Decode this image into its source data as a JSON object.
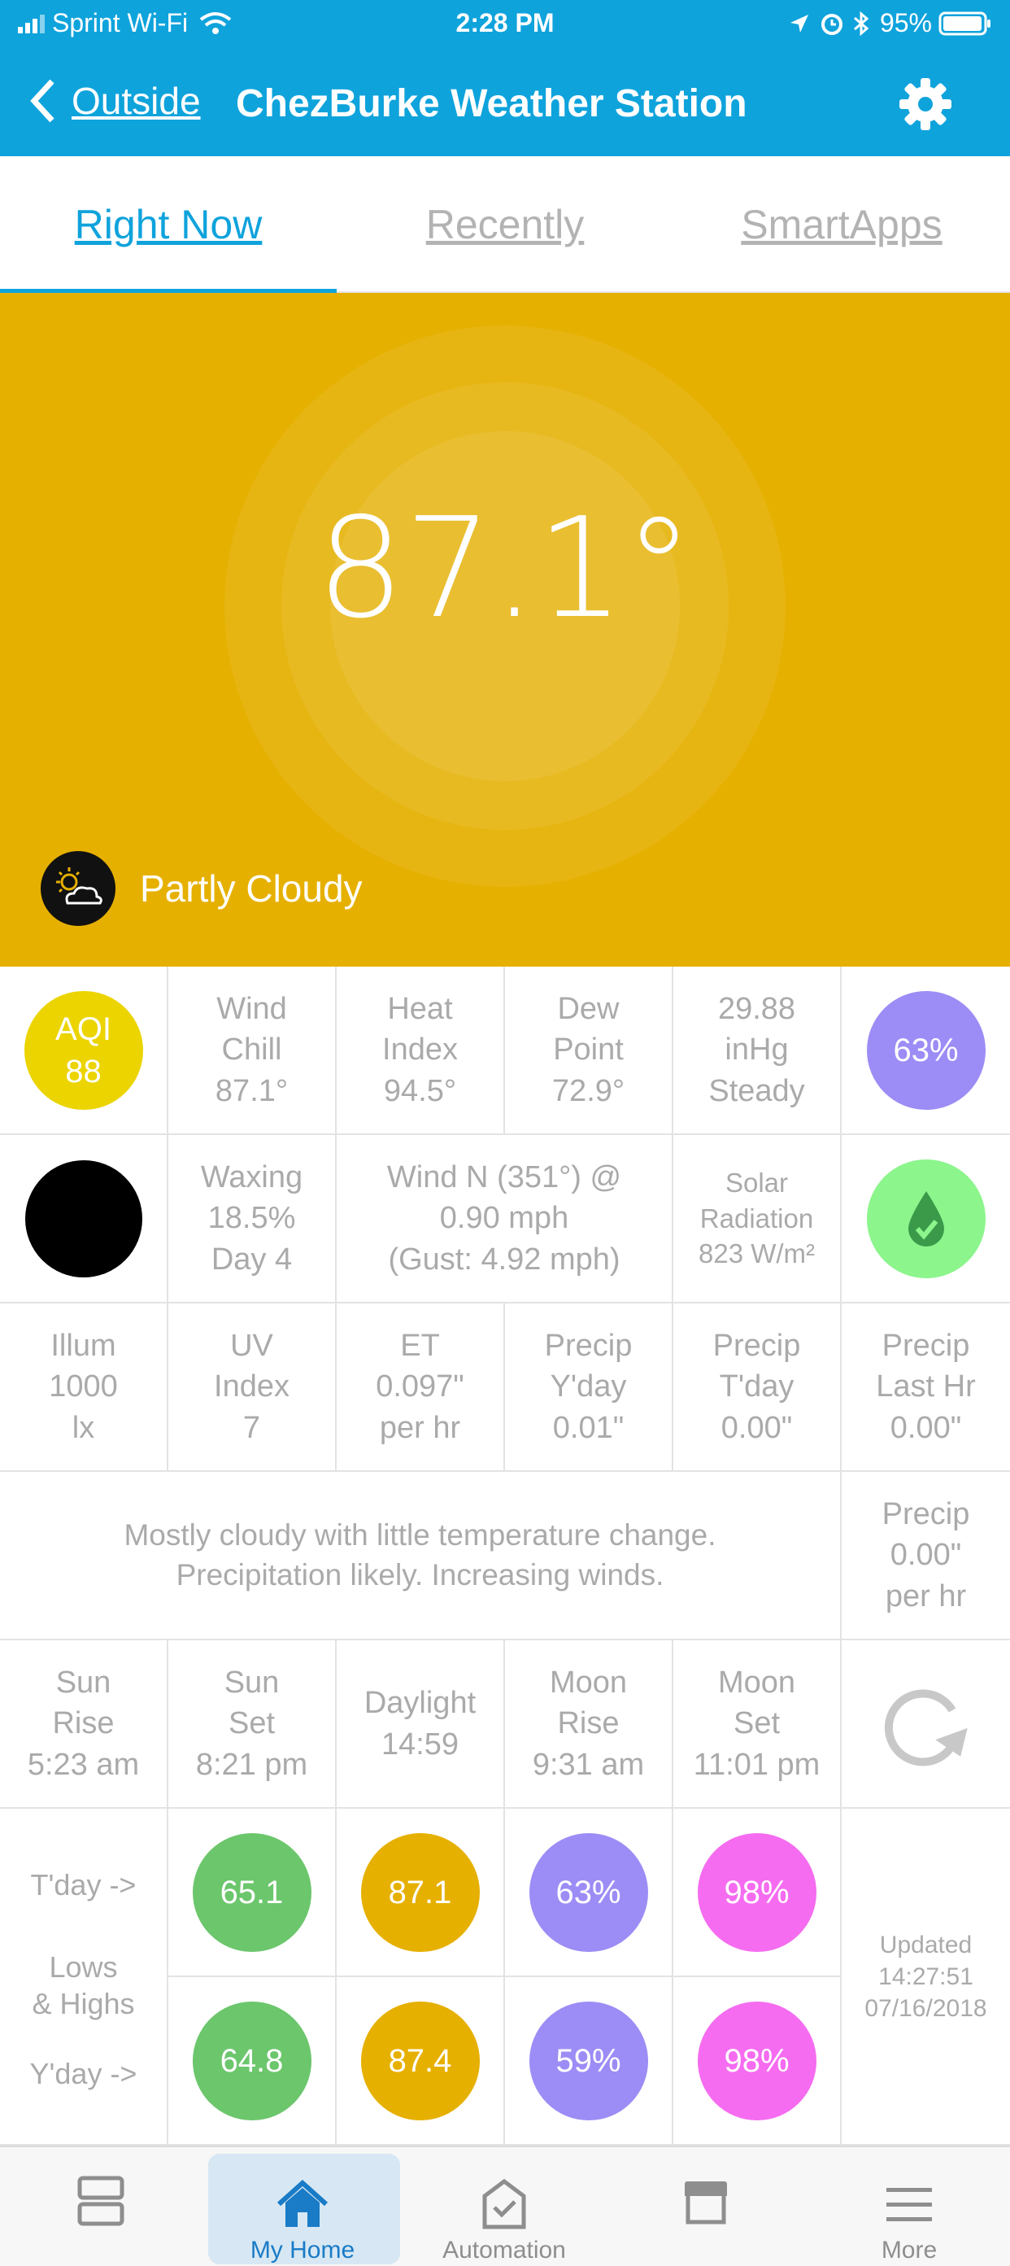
{
  "status_bar": {
    "carrier": "Sprint Wi-Fi",
    "time": "2:28 PM",
    "battery": "95%"
  },
  "nav": {
    "back_label": "Outside",
    "title": "ChezBurke Weather Station"
  },
  "tabs": [
    {
      "label": "Right Now",
      "active": true
    },
    {
      "label": "Recently",
      "active": false
    },
    {
      "label": "SmartApps",
      "active": false
    }
  ],
  "hero": {
    "temperature": "87.1°",
    "condition": "Partly Cloudy",
    "bg_color": "#e6b000"
  },
  "row1": {
    "aqi_line1": "AQI",
    "aqi_line2": "88",
    "aqi_color": "#ebd400",
    "wind_chill": [
      "Wind",
      "Chill",
      "87.1°"
    ],
    "heat_index": [
      "Heat",
      "Index",
      "94.5°"
    ],
    "dew_point": [
      "Dew",
      "Point",
      "72.9°"
    ],
    "pressure": [
      "29.88",
      "inHg",
      "Steady"
    ],
    "humidity": "63%",
    "humidity_color": "#9c8cf5"
  },
  "row2": {
    "moon_phase": [
      "Waxing",
      "18.5%",
      "Day 4"
    ],
    "wind": [
      "Wind N (351°) @",
      "0.90 mph",
      "(Gust: 4.92 mph)"
    ],
    "solar": [
      "Solar",
      "Radiation",
      "823 W/m²"
    ],
    "water_color": "#8cf58c"
  },
  "row3": {
    "illum": [
      "Illum",
      "1000",
      "lx"
    ],
    "uv": [
      "UV",
      "Index",
      "7"
    ],
    "et": [
      "ET",
      "0.097\"",
      "per hr"
    ],
    "precip_yday": [
      "Precip",
      "Y'day",
      "0.01\""
    ],
    "precip_tday": [
      "Precip",
      "T'day",
      "0.00\""
    ],
    "precip_lasthr": [
      "Precip",
      "Last Hr",
      "0.00\""
    ]
  },
  "row4": {
    "forecast": [
      "Mostly cloudy with little temperature change.",
      "Precipitation likely. Increasing winds."
    ],
    "precip_rate": [
      "Precip",
      "0.00\"",
      "per hr"
    ]
  },
  "row5": {
    "sunrise": [
      "Sun",
      "Rise",
      "5:23 am"
    ],
    "sunset": [
      "Sun",
      "Set",
      "8:21 pm"
    ],
    "daylight": [
      "Daylight",
      "14:59"
    ],
    "moonrise": [
      "Moon",
      "Rise",
      "9:31 am"
    ],
    "moonset": [
      "Moon",
      "Set",
      "11:01 pm"
    ]
  },
  "lows_highs": {
    "tday_label": "T'day ->",
    "label": [
      "Lows",
      "& Highs"
    ],
    "yday_label": "Y'day ->",
    "tday": [
      "65.1",
      "87.1",
      "63%",
      "98%"
    ],
    "yday": [
      "64.8",
      "87.4",
      "59%",
      "98%"
    ],
    "colors": [
      "#6cc66c",
      "#e6b000",
      "#9c8cf5",
      "#f56cf0"
    ],
    "updated": [
      "Updated",
      "14:27:51",
      "07/16/2018"
    ]
  },
  "tab_bar": [
    {
      "label": "",
      "icon": "dashboard-icon"
    },
    {
      "label": "My Home",
      "icon": "home-icon",
      "active": true
    },
    {
      "label": "Automation",
      "icon": "automation-icon"
    },
    {
      "label": "",
      "icon": "store-icon"
    },
    {
      "label": "More",
      "icon": "menu-icon"
    }
  ]
}
